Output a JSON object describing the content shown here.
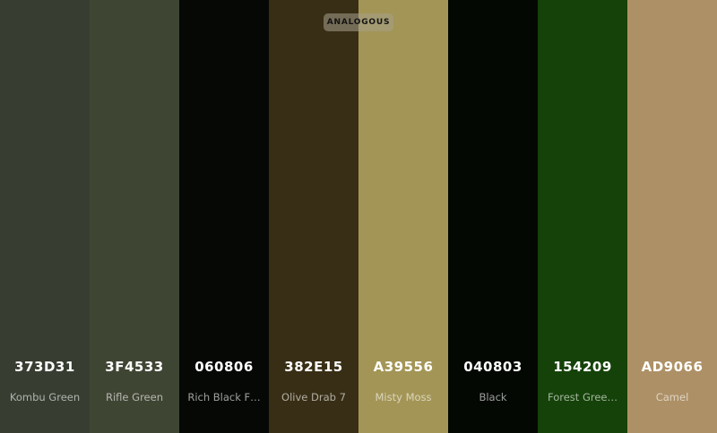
{
  "badge": {
    "label": "ANALOGOUS"
  },
  "swatches": [
    {
      "hex": "373D31",
      "name": "Kombu Green",
      "color": "#373D31"
    },
    {
      "hex": "3F4533",
      "name": "Rifle Green",
      "color": "#3F4533"
    },
    {
      "hex": "060806",
      "name": "Rich Black F…",
      "color": "#060806"
    },
    {
      "hex": "382E15",
      "name": "Olive Drab 7",
      "color": "#382E15"
    },
    {
      "hex": "A39556",
      "name": "Misty Moss",
      "color": "#A39556"
    },
    {
      "hex": "040803",
      "name": "Black",
      "color": "#040803"
    },
    {
      "hex": "154209",
      "name": "Forest Gree…",
      "color": "#154209"
    },
    {
      "hex": "AD9066",
      "name": "Camel",
      "color": "#AD9066"
    }
  ]
}
